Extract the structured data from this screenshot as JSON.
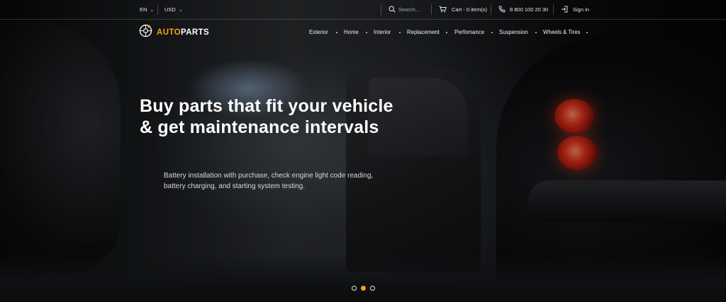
{
  "topbar": {
    "language": "EN",
    "currency": "USD",
    "search_placeholder": "Search...",
    "cart_label": "Cart - 0 item(s)",
    "phone": "8 800 100 20 30",
    "signin_label": "Sign in"
  },
  "brand": {
    "logo_part1": "AUTO",
    "logo_part2": "PARTS",
    "accent_color": "#f3a21b"
  },
  "nav": {
    "items": [
      "Exterior",
      "Home",
      "Interior",
      "Replacement",
      "Perfomance",
      "Suspension",
      "Wheels & Tires"
    ]
  },
  "hero": {
    "headline": "Buy parts that fit your vehicle & get maintenance intervals",
    "subtext": "Battery installation with purchase, check engine light code reading, battery charging, and starting system testing.",
    "slide_count": 3,
    "active_slide": 2
  },
  "icons": {
    "search": "search-icon",
    "cart": "cart-icon",
    "phone": "phone-icon",
    "signin": "signin-icon",
    "logo": "logo-icon",
    "chevron": "chevron-down-icon"
  }
}
